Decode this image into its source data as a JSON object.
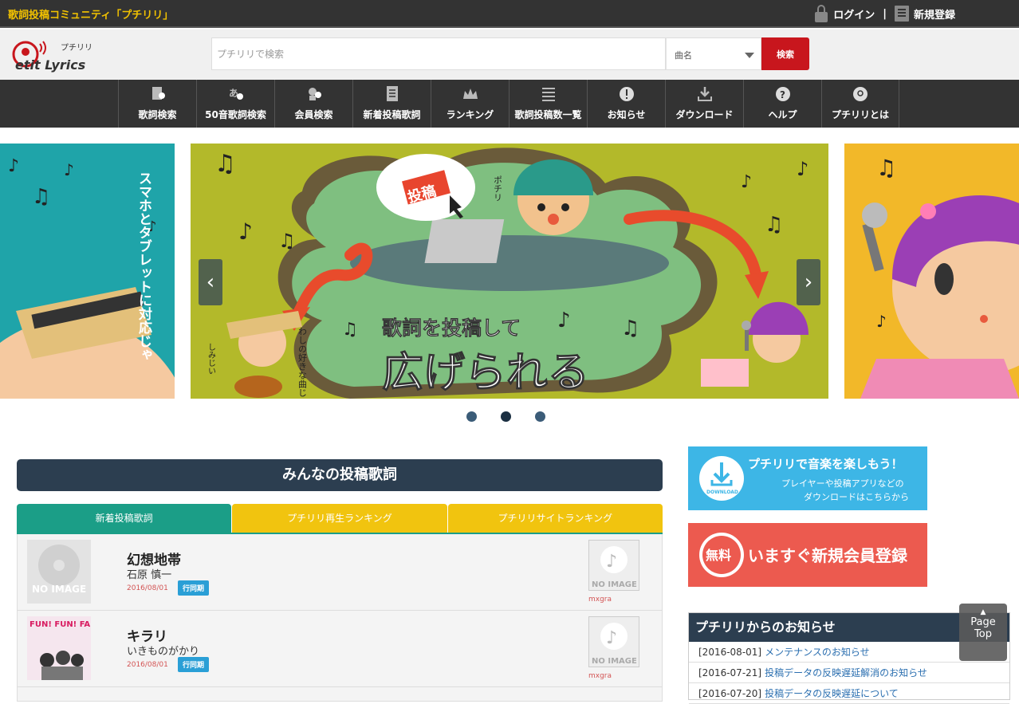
{
  "topbar": {
    "site_title": "歌詞投稿コミュニティ「プチリリ」",
    "login": "ログイン",
    "separator": "|",
    "register": "新規登録"
  },
  "header": {
    "search_placeholder": "プチリリで検索",
    "search_select": "曲名",
    "search_button": "検索"
  },
  "nav": [
    {
      "label": "歌詞検索",
      "icon": "lyrics-search-icon"
    },
    {
      "label": "50音歌詞検索",
      "icon": "kana-search-icon"
    },
    {
      "label": "会員検索",
      "icon": "member-search-icon"
    },
    {
      "label": "新着投稿歌詞",
      "icon": "new-lyrics-icon"
    },
    {
      "label": "ランキング",
      "icon": "crown-icon"
    },
    {
      "label": "歌詞投稿数一覧",
      "icon": "list-icon"
    },
    {
      "label": "お知らせ",
      "icon": "info-icon"
    },
    {
      "label": "ダウンロード",
      "icon": "download-icon"
    },
    {
      "label": "ヘルプ",
      "icon": "help-icon"
    },
    {
      "label": "プチリリとは",
      "icon": "about-icon"
    }
  ],
  "carousel": {
    "main_line1": "歌詞を投稿して",
    "main_line2": "広げられる",
    "bubble": "投稿",
    "char_pochiri": "ポチリ",
    "char_shimijii": "しみじい",
    "speech_left": "わしの好きな曲じゃ",
    "left_text": "スマホとタブレットに対応じゃ",
    "prev_arrow": "‹",
    "next_arrow": "›"
  },
  "lyrics_section": {
    "title": "みんなの投稿歌詞",
    "tabs": [
      "新着投稿歌詞",
      "プチリリ再生ランキング",
      "プチリリサイトランキング"
    ],
    "no_image": "NO IMAGE",
    "songs": [
      {
        "title": "幻想地帯",
        "artist": "石原 慎一",
        "date": "2016/08/01",
        "tag": "行同期",
        "poster": "mxgra",
        "jacket": "no-image"
      },
      {
        "title": "キラリ",
        "artist": "いきものがかり",
        "date": "2016/08/01",
        "tag": "行同期",
        "poster": "mxgra",
        "jacket_text": "FUN! FUN! FANFARE!"
      }
    ]
  },
  "banners": {
    "download_title": "プチリリで音楽を楽しもう！",
    "download_sub1": "プレイヤーや投稿アプリなどの",
    "download_sub2": "ダウンロードはこちらから",
    "download_icon_label": "DOWNLOAD",
    "register_badge": "無料",
    "register_text": "いますぐ新規会員登録"
  },
  "news": {
    "title": "プチリリからのお知らせ",
    "items": [
      {
        "date": "[2016-08-01]",
        "text": "メンテナンスのお知らせ"
      },
      {
        "date": "[2016-07-21]",
        "text": "投稿データの反映遅延解消のお知らせ"
      },
      {
        "date": "[2016-07-20]",
        "text": "投稿データの反映遅延について"
      }
    ]
  },
  "page_top": {
    "arrow": "▲",
    "line1": "Page",
    "line2": "Top"
  },
  "colors": {
    "accent_red": "#c8161d",
    "nav_bg": "#333333",
    "teal": "#1b9e87",
    "yellow": "#f1c40f",
    "navy": "#2c3e50"
  }
}
